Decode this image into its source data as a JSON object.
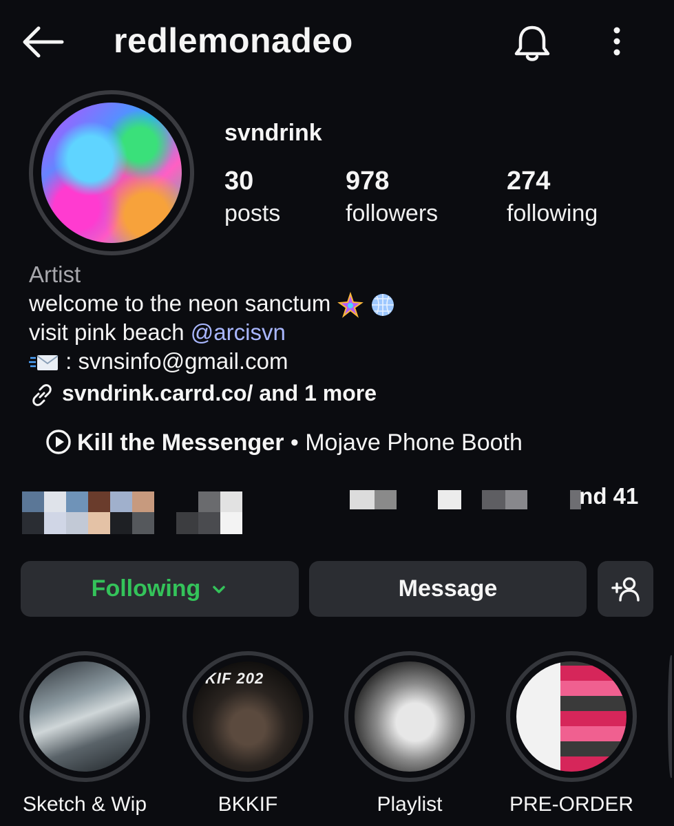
{
  "header": {
    "username": "redlemonadeo"
  },
  "profile": {
    "display_name": "svndrink",
    "stats": [
      {
        "count": "30",
        "label": "posts"
      },
      {
        "count": "978",
        "label": "followers"
      },
      {
        "count": "274",
        "label": "following"
      }
    ],
    "category": "Artist",
    "bio": {
      "line1": "welcome to the neon sanctum",
      "line2_prefix": "visit pink beach",
      "line2_mention": "@arcisvn",
      "line3": ": svnsinfo@gmail.com"
    },
    "link": "svndrink.carrd.co/ and 1 more",
    "music": {
      "song": "Kill the Messenger",
      "separator": "•",
      "artist": "Mojave Phone Booth"
    },
    "mutual_suffix": "nd 41"
  },
  "actions": {
    "following_label": "Following",
    "message_label": "Message"
  },
  "highlights": [
    {
      "label": "Sketch & Wip"
    },
    {
      "label": "BKKIF"
    },
    {
      "label": "Playlist"
    },
    {
      "label": "PRE-ORDER"
    }
  ],
  "bkkif_cover_text": "KIF 202",
  "colors": {
    "background": "#0b0c10",
    "button": "#2b2d32",
    "following_green": "#34c35a",
    "mention": "#a9b7ff",
    "secondary_text": "#a8a8ad"
  },
  "icons": [
    "back-arrow-icon",
    "bell-icon",
    "more-vertical-icon",
    "link-icon",
    "play-icon",
    "chevron-down-icon",
    "add-user-icon"
  ]
}
